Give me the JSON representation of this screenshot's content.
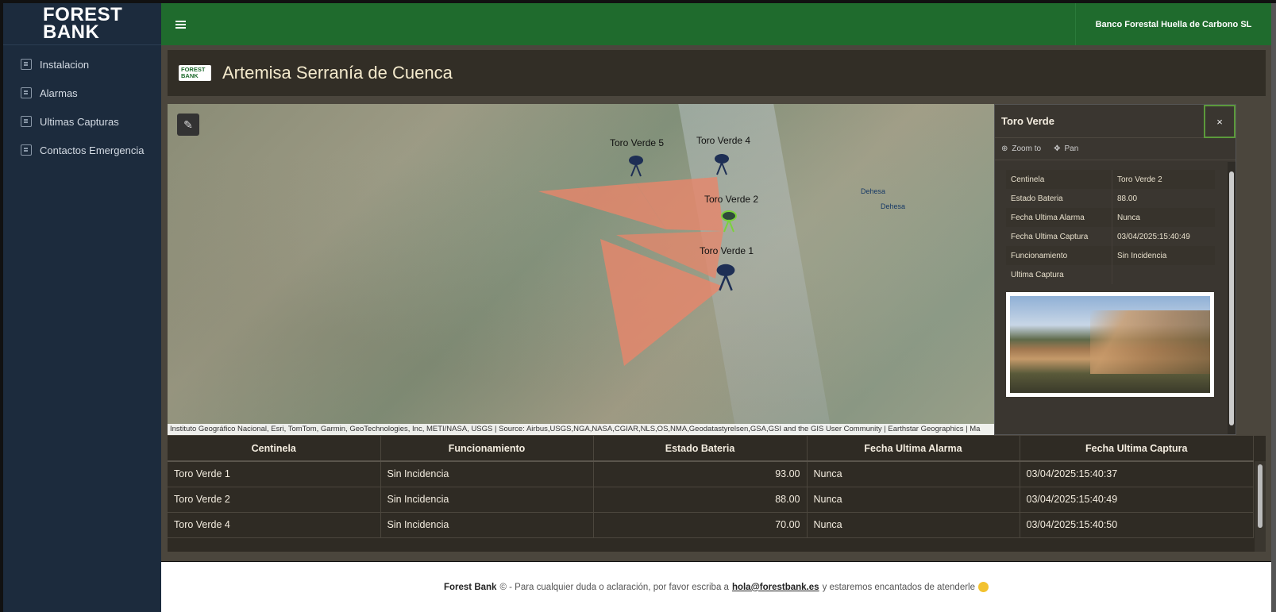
{
  "brand": {
    "logo_line1": "FOREST",
    "logo_line2": "BANK",
    "mini_logo": "FOREST BANK"
  },
  "sidebar": {
    "items": [
      {
        "label": "Instalacion",
        "icon": "book-icon"
      },
      {
        "label": "Alarmas",
        "icon": "layout-icon"
      },
      {
        "label": "Ultimas Capturas",
        "icon": "chart-icon"
      },
      {
        "label": "Contactos Emergencia",
        "icon": "contacts-icon"
      }
    ]
  },
  "header": {
    "company": "Banco Forestal Huella de Carbono SL"
  },
  "page": {
    "title": "Artemisa Serranía de Cuenca"
  },
  "map": {
    "markers": [
      "Toro Verde 5",
      "Toro Verde 4",
      "Toro Verde 2",
      "Toro Verde 1"
    ],
    "places": [
      "Dehesa",
      "Dehesa"
    ],
    "attribution": "Instituto Geográfico Nacional, Esri, TomTom, Garmin, GeoTechnologies, Inc, METI/NASA, USGS | Source: Airbus,USGS,NGA,NASA,CGIAR,NLS,OS,NMA,Geodatastyrelsen,GSA,GSI and the GIS User Community | Earthstar Geographics | Ma"
  },
  "popup": {
    "title": "Toro Verde",
    "close": "×",
    "zoom_label": "Zoom to",
    "pan_label": "Pan",
    "rows": [
      {
        "k": "Centinela",
        "v": "Toro Verde 2"
      },
      {
        "k": "Estado Bateria",
        "v": "88.00"
      },
      {
        "k": "Fecha Ultima Alarma",
        "v": "Nunca"
      },
      {
        "k": "Fecha Ultima Captura",
        "v": "03/04/2025:15:40:49"
      },
      {
        "k": "Funcionamiento",
        "v": "Sin Incidencia"
      },
      {
        "k": "Ultima Captura",
        "v": ""
      }
    ]
  },
  "table": {
    "headers": [
      "Centinela",
      "Funcionamiento",
      "Estado Bateria",
      "Fecha Ultima Alarma",
      "Fecha Ultima Captura"
    ],
    "rows": [
      [
        "Toro Verde 1",
        "Sin Incidencia",
        "93.00",
        "Nunca",
        "03/04/2025:15:40:37"
      ],
      [
        "Toro Verde 2",
        "Sin Incidencia",
        "88.00",
        "Nunca",
        "03/04/2025:15:40:49"
      ],
      [
        "Toro Verde 4",
        "Sin Incidencia",
        "70.00",
        "Nunca",
        "03/04/2025:15:40:50"
      ]
    ]
  },
  "footer": {
    "brand": "Forest Bank",
    "copy": "©",
    "text1": "- Para cualquier duda o aclaración, por favor escriba a",
    "email": "hola@forestbank.es",
    "text2": "y estaremos encantados de atenderle"
  },
  "colors": {
    "header_green": "#1f6b2d",
    "sidebar": "#1c2b3d",
    "content_bg": "#4b463d",
    "polygon": "#e8866a",
    "marker": "#1e2f55"
  }
}
